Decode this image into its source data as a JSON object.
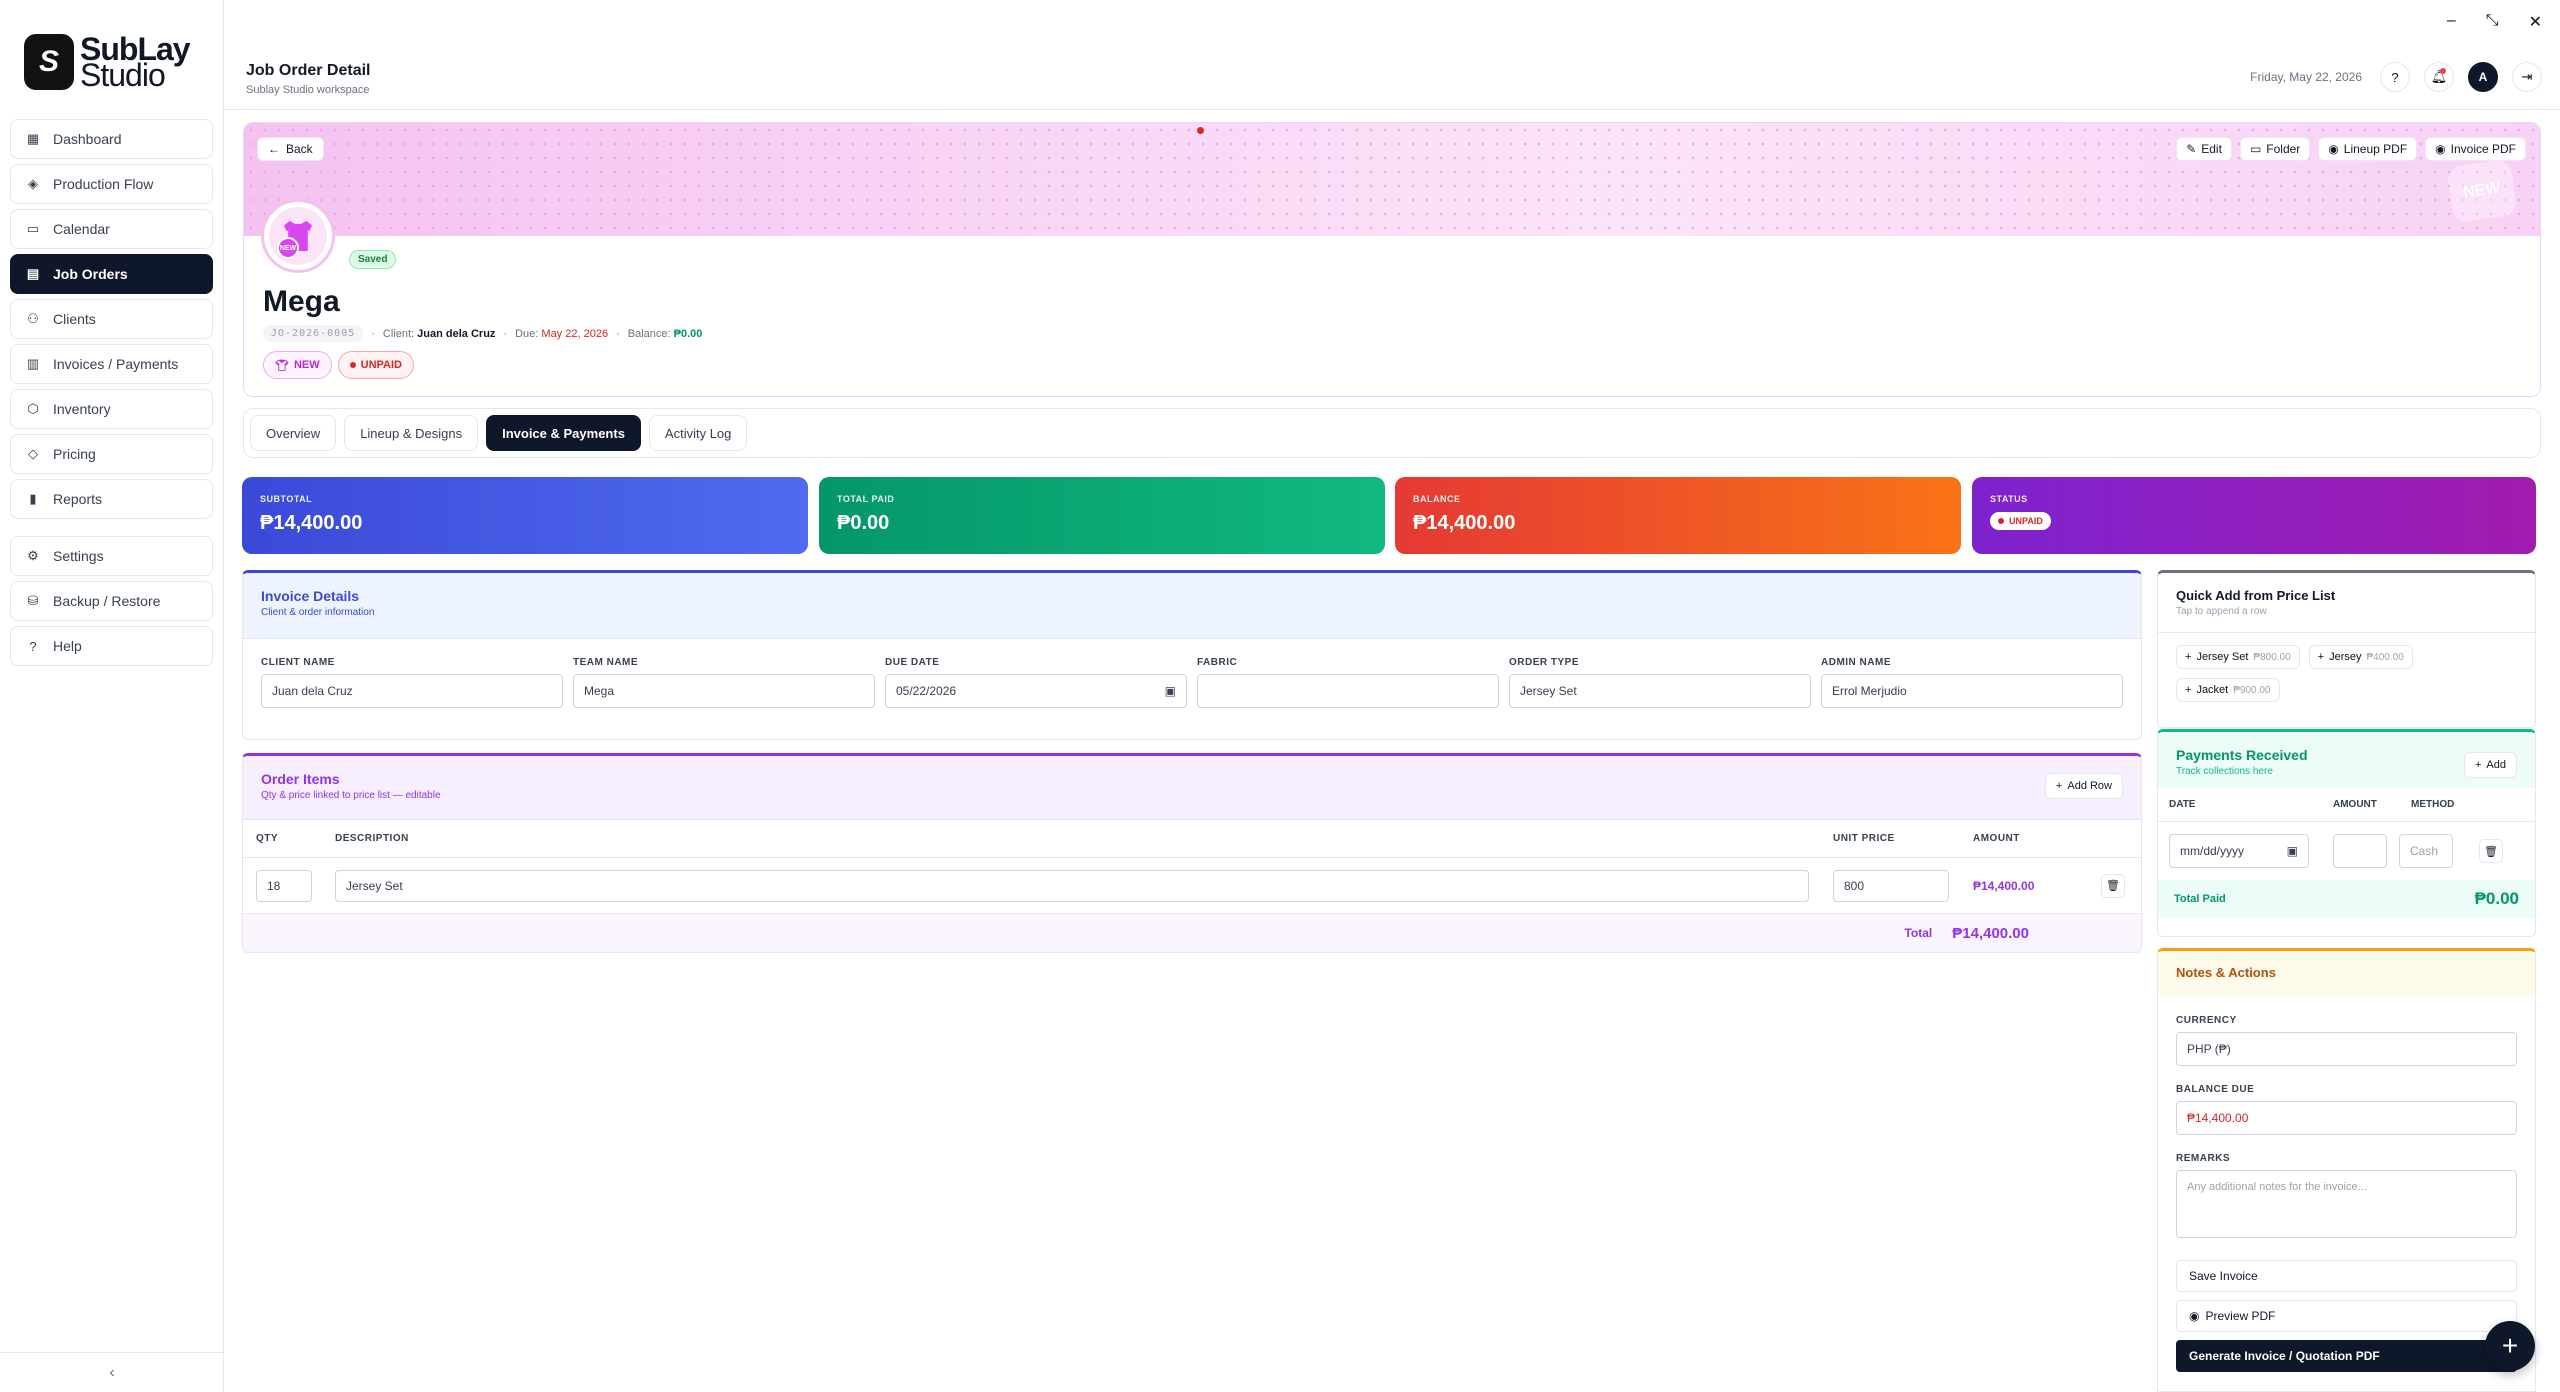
{
  "app": {
    "logo_line1": "SubLay",
    "logo_line2": "Studio",
    "logo_mark": "S"
  },
  "sidebar": {
    "items": [
      {
        "label": "Dashboard",
        "icon": "grid-icon"
      },
      {
        "label": "Production Flow",
        "icon": "layers-icon"
      },
      {
        "label": "Calendar",
        "icon": "calendar-icon"
      },
      {
        "label": "Job Orders",
        "icon": "document-icon",
        "active": true
      },
      {
        "label": "Clients",
        "icon": "users-icon"
      },
      {
        "label": "Invoices / Payments",
        "icon": "receipt-icon"
      },
      {
        "label": "Inventory",
        "icon": "box-icon"
      },
      {
        "label": "Pricing",
        "icon": "tag-icon"
      },
      {
        "label": "Reports",
        "icon": "bar-chart-icon"
      }
    ],
    "secondary": [
      {
        "label": "Settings",
        "icon": "gear-icon"
      },
      {
        "label": "Backup / Restore",
        "icon": "database-icon"
      },
      {
        "label": "Help",
        "icon": "help-icon"
      }
    ],
    "collapse_glyph": "‹"
  },
  "topbar": {
    "title": "Job Order Detail",
    "subtitle": "Sublay Studio workspace",
    "date": "Friday, May 22, 2026",
    "avatar_initial": "A"
  },
  "hero": {
    "back_label": "Back",
    "actions": [
      "Edit",
      "Folder",
      "Lineup PDF",
      "Invoice PDF"
    ],
    "watermark": "NEW",
    "avatar_stamp": "NEW",
    "saved_badge": "Saved",
    "title": "Mega",
    "code": "JO-2026-0005",
    "client_label": "Client:",
    "client": "Juan dela Cruz",
    "due_label": "Due:",
    "due": "May 22, 2026",
    "balance_label": "Balance:",
    "balance": "₱0.00",
    "status_new": "NEW",
    "status_payment": "UNPAID"
  },
  "tabs": [
    "Overview",
    "Lineup & Designs",
    "Invoice & Payments",
    "Activity Log"
  ],
  "active_tab": "Invoice & Payments",
  "stats": {
    "subtotal": {
      "label": "SUBTOTAL",
      "value": "₱14,400.00"
    },
    "total_paid": {
      "label": "TOTAL PAID",
      "value": "₱0.00"
    },
    "balance": {
      "label": "BALANCE",
      "value": "₱14,400.00"
    },
    "status": {
      "label": "STATUS",
      "value": "UNPAID"
    }
  },
  "invoice_details": {
    "title": "Invoice Details",
    "subtitle": "Client & order information",
    "fields": [
      {
        "label": "CLIENT NAME",
        "value": "Juan dela Cruz"
      },
      {
        "label": "TEAM NAME",
        "value": "Mega"
      },
      {
        "label": "DUE DATE",
        "value": "05/22/2026"
      },
      {
        "label": "FABRIC",
        "value": ""
      },
      {
        "label": "ORDER TYPE",
        "value": "Jersey Set"
      },
      {
        "label": "ADMIN NAME",
        "value": "Errol Merjudio"
      }
    ]
  },
  "order_items": {
    "title": "Order Items",
    "subtitle": "Qty & price linked to price list — editable",
    "add_row_label": "Add Row",
    "columns": [
      "QTY",
      "DESCRIPTION",
      "UNIT PRICE",
      "AMOUNT"
    ],
    "rows": [
      {
        "qty": "18",
        "description": "Jersey Set",
        "unit_price": "800",
        "amount": "₱14,400.00"
      }
    ],
    "total_label": "Total",
    "total_value": "₱14,400.00"
  },
  "quick_add": {
    "title": "Quick Add from Price List",
    "subtitle": "Tap to append a row",
    "items": [
      {
        "name": "Jersey Set",
        "price": "₱800.00"
      },
      {
        "name": "Jersey",
        "price": "₱400.00"
      },
      {
        "name": "Jacket",
        "price": "₱900.00"
      }
    ]
  },
  "payments": {
    "title": "Payments Received",
    "subtitle": "Track collections here",
    "add_label": "Add",
    "columns": [
      "DATE",
      "AMOUNT",
      "METHOD"
    ],
    "date_placeholder": "mm/dd/yyyy",
    "method_placeholder": "Cash",
    "total_label": "Total Paid",
    "total_value": "₱0.00"
  },
  "notes": {
    "title": "Notes & Actions",
    "currency_label": "CURRENCY",
    "currency_value": "PHP (₱)",
    "balance_due_label": "BALANCE DUE",
    "balance_due_value": "₱14,400.00",
    "remarks_label": "REMARKS",
    "remarks_placeholder": "Any additional notes for the invoice...",
    "save_label": "Save Invoice",
    "preview_label": "Preview PDF",
    "generate_label": "Generate Invoice / Quotation PDF"
  },
  "colors": {
    "accent_dark": "#0f172a",
    "subtotal": "#3b49d8",
    "paid": "#059669",
    "balance": "#f97316",
    "status": "#7e22ce"
  }
}
